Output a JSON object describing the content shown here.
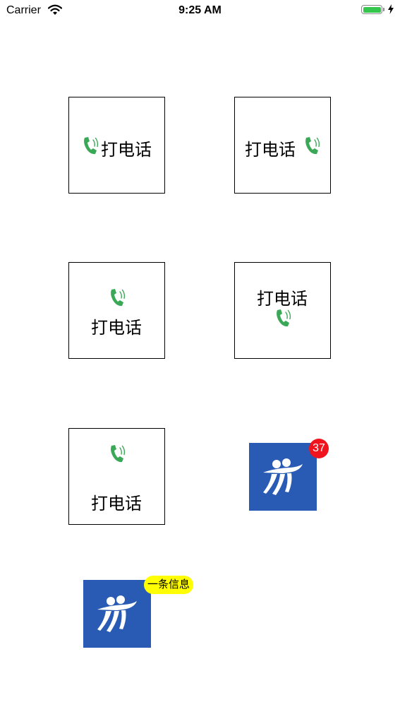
{
  "status_bar": {
    "carrier": "Carrier",
    "time": "9:25 AM",
    "battery_level": 1.0,
    "battery_color": "#35c64d"
  },
  "buttons": [
    {
      "label": "打电话",
      "icon": "phone-icon",
      "layout": "icon-left"
    },
    {
      "label": "打电话",
      "icon": "phone-icon",
      "layout": "icon-right"
    },
    {
      "label": "打电话",
      "icon": "phone-icon",
      "layout": "icon-top"
    },
    {
      "label": "打电话",
      "icon": "phone-icon",
      "layout": "icon-bottom"
    },
    {
      "label": "打电话",
      "icon": "phone-icon",
      "layout": "icon-top-spaced"
    }
  ],
  "app_icons": [
    {
      "icon": "app-logo-icon",
      "badge": "37",
      "badge_color": "#f0141e"
    },
    {
      "icon": "app-logo-icon",
      "badge": "一条信息",
      "badge_color": "#ffff00"
    }
  ],
  "colors": {
    "phone_icon": "#3aa856",
    "app_icon_bg": "#2a5bb4"
  }
}
